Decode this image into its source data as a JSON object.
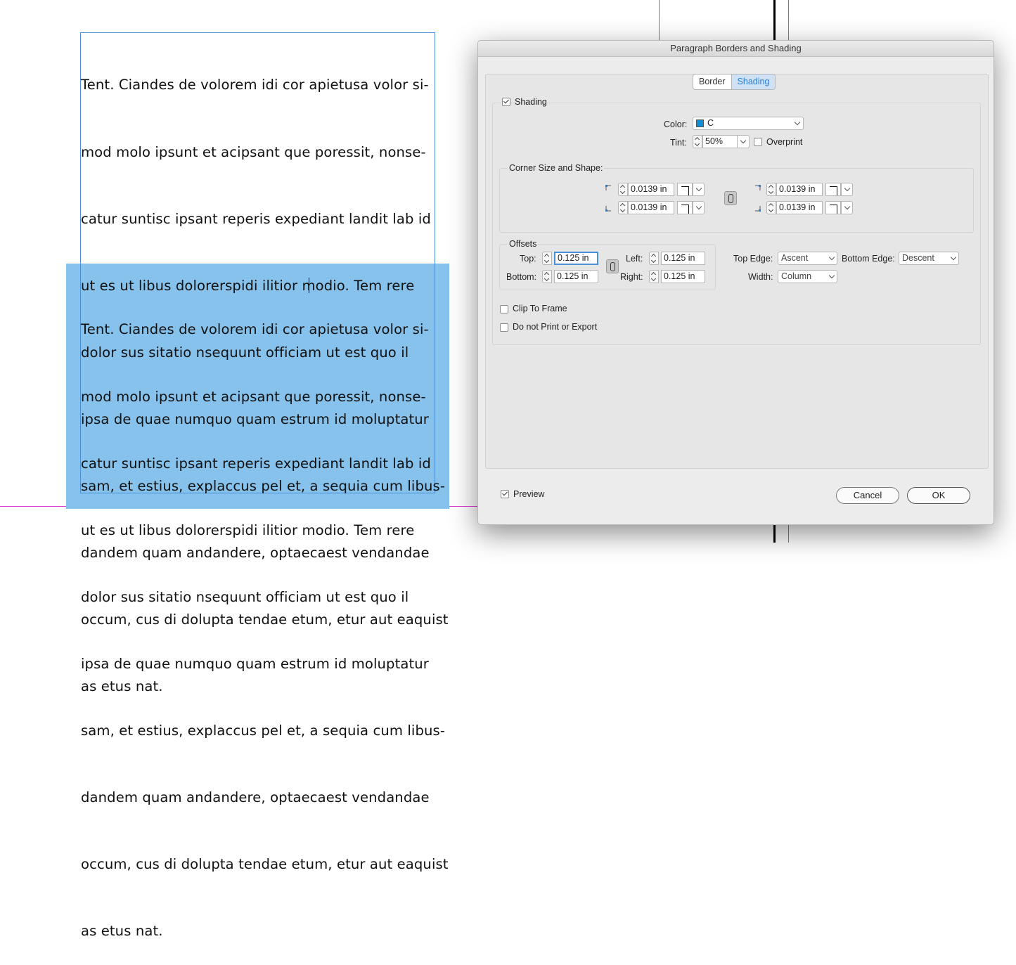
{
  "document": {
    "paragraph_lines": [
      "Tent. Ciandes de volorem idi cor apietusa volor si-",
      "mod molo ipsunt et acipsant que poressit, nonse-",
      "catur suntisc ipsant reperis expediant landit lab id",
      "ut es ut libus dolorerspidi ilitior modio. Tem rere",
      "dolor sus sitatio nsequunt officiam ut est quo il",
      "ipsa de quae numquo quam estrum id moluptatur",
      "sam, et estius, explaccus pel et, a sequia cum libus-",
      "dandem quam andandere, optaecaest vendandae",
      "occum, cus di dolupta tendae etum, etur aut eaquist",
      "as etus nat."
    ],
    "shading_color": "#86c2ec",
    "guide_color": "#e03ad0"
  },
  "dialog": {
    "title": "Paragraph Borders and Shading",
    "tabs": [
      "Border",
      "Shading"
    ],
    "active_tab": "Shading",
    "shading": {
      "checkbox_label": "Shading",
      "checked": true,
      "color_label": "Color:",
      "color_value": "C",
      "color_swatch": "#0e8fd6",
      "tint_label": "Tint:",
      "tint_value": "50%",
      "overprint_label": "Overprint",
      "overprint_checked": false
    },
    "corner": {
      "title": "Corner Size and Shape:",
      "top_left": "0.0139 in",
      "bottom_left": "0.0139 in",
      "top_right": "0.0139 in",
      "bottom_right": "0.0139 in"
    },
    "offsets": {
      "title": "Offsets",
      "top_label": "Top:",
      "top_value": "0.125 in",
      "bottom_label": "Bottom:",
      "bottom_value": "0.125 in",
      "left_label": "Left:",
      "left_value": "0.125 in",
      "right_label": "Right:",
      "right_value": "0.125 in"
    },
    "edges": {
      "top_edge_label": "Top Edge:",
      "top_edge_value": "Ascent",
      "bottom_edge_label": "Bottom Edge:",
      "bottom_edge_value": "Descent",
      "width_label": "Width:",
      "width_value": "Column"
    },
    "clip_to_frame_label": "Clip To Frame",
    "clip_to_frame_checked": false,
    "do_not_print_label": "Do not Print or Export",
    "do_not_print_checked": false,
    "preview_label": "Preview",
    "preview_checked": true,
    "cancel_label": "Cancel",
    "ok_label": "OK"
  }
}
